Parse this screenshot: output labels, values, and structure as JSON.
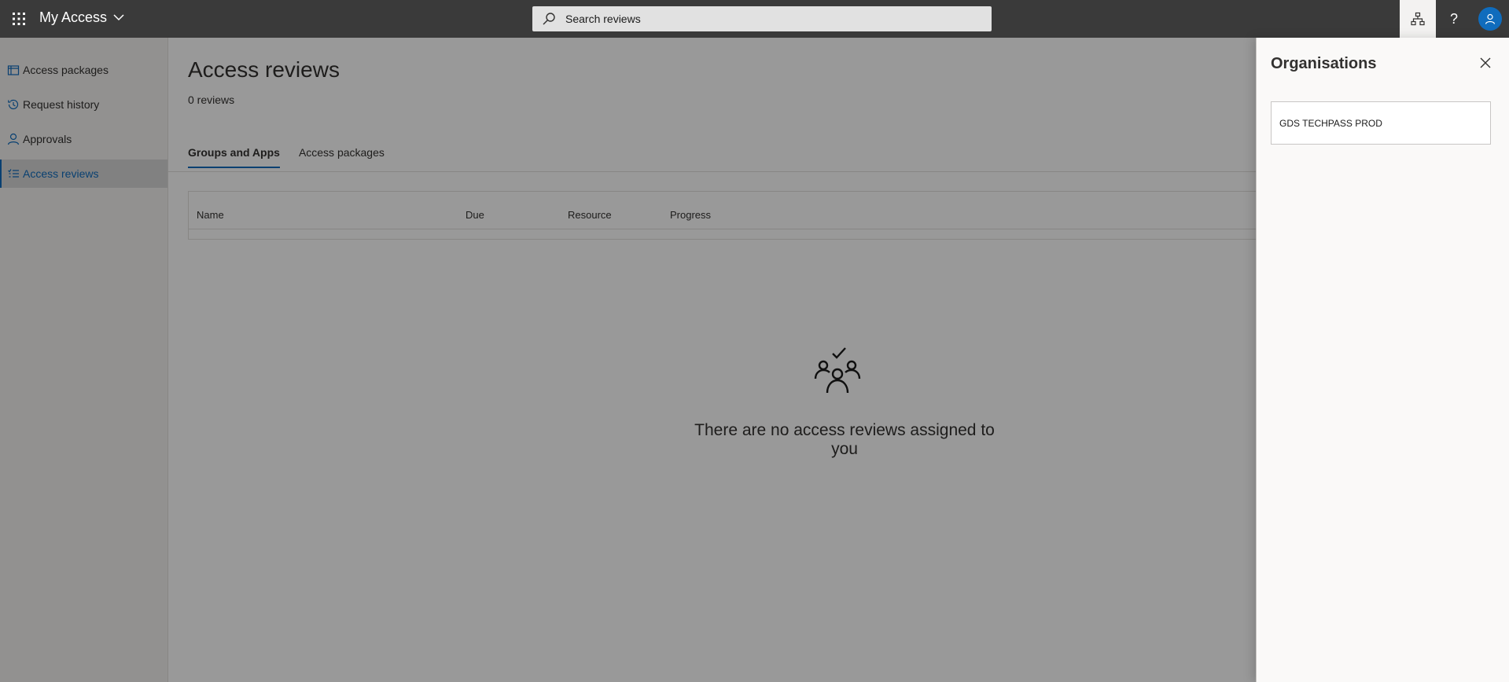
{
  "topbar": {
    "app_title": "My Access",
    "search_placeholder": "Search reviews"
  },
  "sidebar": {
    "items": [
      {
        "label": "Access packages",
        "icon": "package-icon"
      },
      {
        "label": "Request history",
        "icon": "history-icon"
      },
      {
        "label": "Approvals",
        "icon": "person-icon"
      },
      {
        "label": "Access reviews",
        "icon": "review-list-icon",
        "selected": true
      }
    ]
  },
  "main": {
    "title": "Access reviews",
    "count": "0 reviews",
    "tabs": [
      {
        "label": "Groups and Apps",
        "active": true
      },
      {
        "label": "Access packages",
        "active": false
      }
    ],
    "columns": [
      "Name",
      "Due",
      "Resource",
      "Progress"
    ],
    "empty_message": "There are no access reviews assigned to you"
  },
  "panel": {
    "title": "Organisations",
    "organisations": [
      "GDS TECHPASS PROD"
    ]
  },
  "colors": {
    "accent": "#0f6cbd",
    "topbar": "#3a3a3a",
    "overlay": "rgba(0,0,0,0.4)"
  }
}
